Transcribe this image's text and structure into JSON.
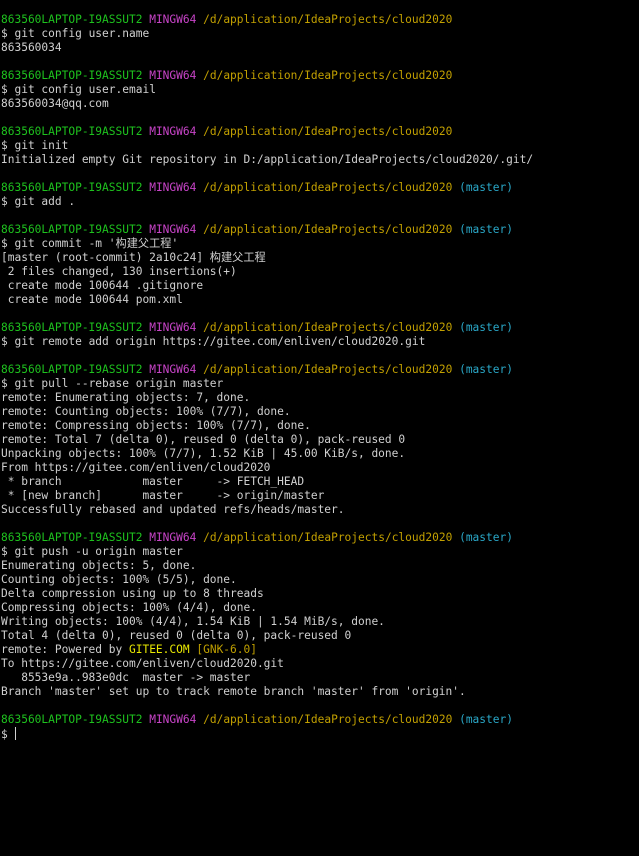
{
  "prompt": {
    "user_host": "863560LAPTOP-I9ASSUT2",
    "system": "MINGW64",
    "path": "/d/application/IdeaProjects/cloud2020",
    "branch": "(master)",
    "symbol": "$ "
  },
  "blocks": [
    {
      "show_branch": false,
      "command": "git config user.name",
      "output": [
        "863560034"
      ]
    },
    {
      "show_branch": false,
      "command": "git config user.email",
      "output": [
        "863560034@qq.com"
      ]
    },
    {
      "show_branch": false,
      "command": "git init",
      "output": [
        "Initialized empty Git repository in D:/application/IdeaProjects/cloud2020/.git/"
      ]
    },
    {
      "show_branch": true,
      "command": "git add .",
      "output": []
    },
    {
      "show_branch": true,
      "command": "git commit -m '构建父工程'",
      "output": [
        "[master (root-commit) 2a10c24] 构建父工程",
        " 2 files changed, 130 insertions(+)",
        " create mode 100644 .gitignore",
        " create mode 100644 pom.xml"
      ]
    },
    {
      "show_branch": true,
      "command": "git remote add origin https://gitee.com/enliven/cloud2020.git",
      "output": []
    },
    {
      "show_branch": true,
      "command": "git pull --rebase origin master",
      "output": [
        "remote: Enumerating objects: 7, done.",
        "remote: Counting objects: 100% (7/7), done.",
        "remote: Compressing objects: 100% (7/7), done.",
        "remote: Total 7 (delta 0), reused 0 (delta 0), pack-reused 0",
        "Unpacking objects: 100% (7/7), 1.52 KiB | 45.00 KiB/s, done.",
        "From https://gitee.com/enliven/cloud2020",
        " * branch            master     -> FETCH_HEAD",
        " * [new branch]      master     -> origin/master",
        "Successfully rebased and updated refs/heads/master."
      ]
    },
    {
      "show_branch": true,
      "command": "git push -u origin master",
      "output": [
        "Enumerating objects: 5, done.",
        "Counting objects: 100% (5/5), done.",
        "Delta compression using up to 8 threads",
        "Compressing objects: 100% (4/4), done.",
        "Writing objects: 100% (4/4), 1.54 KiB | 1.54 MiB/s, done.",
        "Total 4 (delta 0), reused 0 (delta 0), pack-reused 0"
      ],
      "powered": {
        "prefix": "remote: Powered by ",
        "gitee": "GITEE.COM",
        "gnk": "[GNK-6.0]"
      },
      "output_after": [
        "To https://gitee.com/enliven/cloud2020.git",
        "   8553e9a..983e0dc  master -> master",
        "Branch 'master' set up to track remote branch 'master' from 'origin'."
      ]
    }
  ],
  "final": {
    "show_branch": true,
    "input": ""
  },
  "colors": {
    "background": "#000000",
    "text": "#d0d0d0",
    "user_host": "#1ec21e",
    "system": "#c844c8",
    "path": "#c2a000",
    "branch": "#2aa8c8",
    "gitee_highlight": "#e8e800"
  }
}
